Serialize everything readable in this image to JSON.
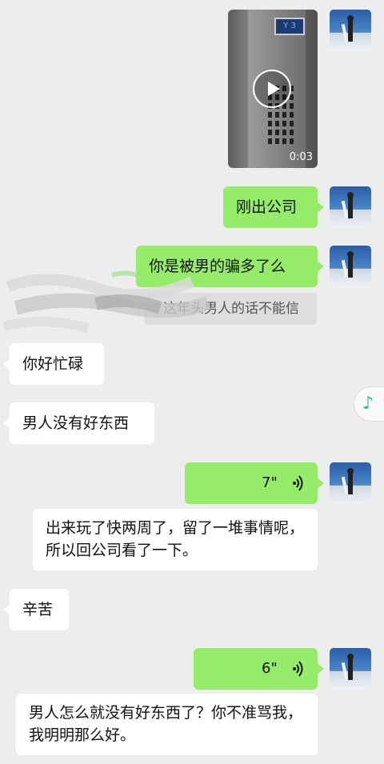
{
  "video_message": {
    "duration": "0:03",
    "screen_text": "Y 3"
  },
  "messages": {
    "m1": "刚出公司",
    "m2": "你是被男的骗多了么",
    "quote": "这年头男人的话不能信",
    "m3": "你好忙碌",
    "m4": "男人没有好东西",
    "voice1": "7\"",
    "m5": "出来玩了快两周了，留了一堆事情呢，所以回公司看了一下。",
    "m6": "辛苦",
    "voice2": "6\"",
    "m7": "男人怎么就没有好东西了？你不准骂我，我明明那么好。"
  },
  "colors": {
    "sent_bubble": "#95ec69",
    "received_bubble": "#ffffff",
    "background": "#ededed"
  },
  "icons": {
    "play": "play-icon",
    "voice": "voice-wave-icon",
    "music": "music-note-icon"
  }
}
